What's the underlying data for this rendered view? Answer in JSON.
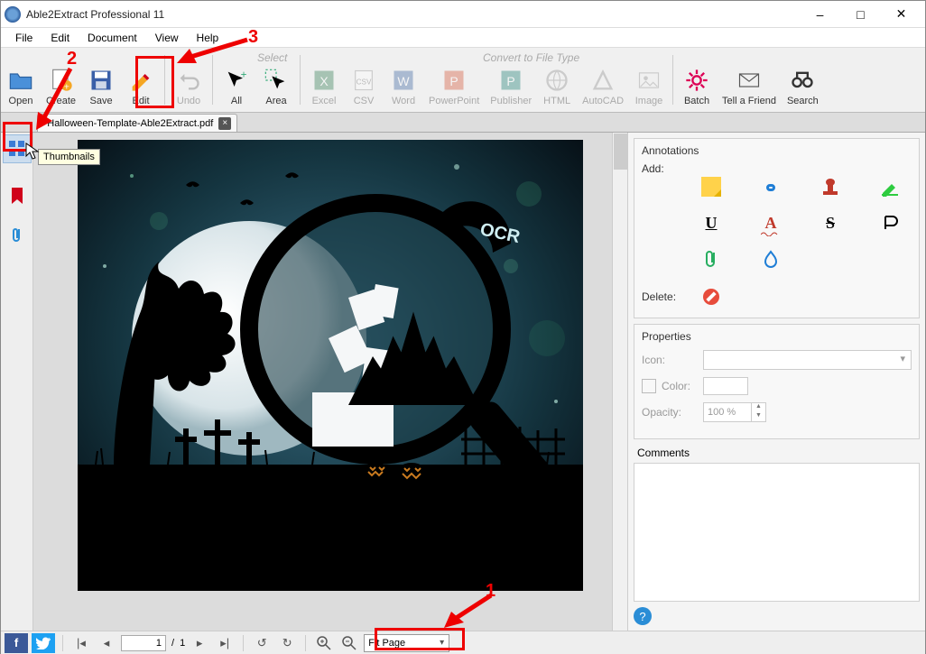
{
  "titlebar": {
    "title": "Able2Extract Professional 11"
  },
  "menu": {
    "file": "File",
    "edit": "Edit",
    "document": "Document",
    "view": "View",
    "help": "Help"
  },
  "toolbar": {
    "section_select": "Select",
    "section_convert": "Convert to File Type",
    "open": "Open",
    "create": "Create",
    "save": "Save",
    "edit": "Edit",
    "undo": "Undo",
    "all": "All",
    "area": "Area",
    "excel": "Excel",
    "csv": "CSV",
    "word": "Word",
    "ppt": "PowerPoint",
    "publisher": "Publisher",
    "html": "HTML",
    "autocad": "AutoCAD",
    "image": "Image",
    "batch": "Batch",
    "tell": "Tell a Friend",
    "search": "Search"
  },
  "tab": {
    "filename": "*Halloween-Template-Able2Extract.pdf"
  },
  "tooltip": {
    "thumbnails": "Thumbnails"
  },
  "rightpanel": {
    "annotations": "Annotations",
    "add": "Add:",
    "delete": "Delete:",
    "properties": "Properties",
    "icon": "Icon:",
    "color": "Color:",
    "opacity": "Opacity:",
    "opacity_value": "100 %",
    "comments": "Comments"
  },
  "bottombar": {
    "page_current": "1",
    "page_sep": "/",
    "page_total": "1",
    "zoom": "Fit Page"
  },
  "callouts": {
    "n1": "1",
    "n2": "2",
    "n3": "3"
  },
  "doc_watermark": "OCR"
}
